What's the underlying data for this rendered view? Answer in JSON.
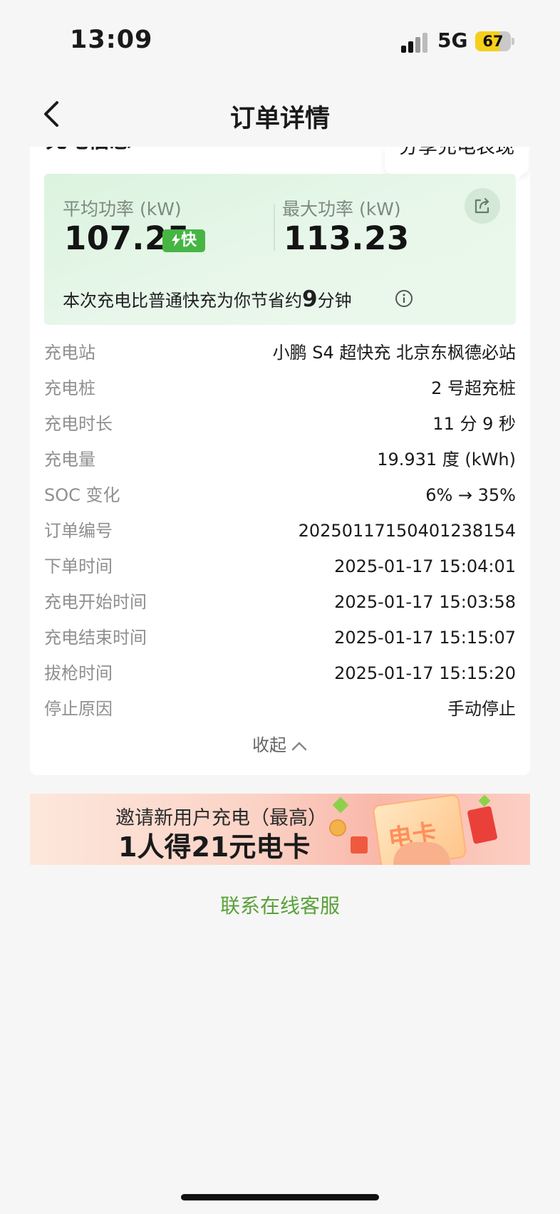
{
  "status_bar": {
    "time": "13:09",
    "network": "5G",
    "battery": "67",
    "battery_level": 0.67
  },
  "nav": {
    "title": "订单详情",
    "back_icon": "chevron-left-icon"
  },
  "section": {
    "title": "充电信息",
    "share_tooltip": "分享充电表现"
  },
  "power": {
    "avg_label": "平均功率 (kW)",
    "avg_value": "107.25",
    "fast_badge": "快",
    "max_label": "最大功率 (kW)",
    "max_value": "113.23",
    "share_icon": "share-icon",
    "saving_prefix": "本次充电比普通快充为你节省约",
    "saving_minutes": "9",
    "saving_suffix": "分钟",
    "info_icon": "info-icon"
  },
  "details": [
    {
      "label": "充电站",
      "value": "小鹏 S4 超快充 北京东枫德必站"
    },
    {
      "label": "充电桩",
      "value": "2 号超充桩"
    },
    {
      "label": "充电时长",
      "value": "11 分 9 秒"
    },
    {
      "label": "充电量",
      "value": "19.931 度 (kWh)"
    },
    {
      "label": "SOC 变化",
      "value": "6% → 35%"
    },
    {
      "label": "订单编号",
      "value": "2025011715040123​8154"
    },
    {
      "label": "下单时间",
      "value": "2025-01-17 15:04:01"
    },
    {
      "label": "充电开始时间",
      "value": "2025-01-17 15:03:58"
    },
    {
      "label": "充电结束时间",
      "value": "2025-01-17 15:15:07"
    },
    {
      "label": "拔枪时间",
      "value": "2025-01-17 15:15:20"
    },
    {
      "label": "停止原因",
      "value": "手动停止"
    }
  ],
  "collapse_label": "收起",
  "banner": {
    "line1": "邀请新用户充电（最高）",
    "line2": "1人得21元电卡",
    "card_text": "电卡"
  },
  "contact_label": "联系在线客服",
  "colors": {
    "accent_green": "#47b543",
    "link_green": "#5aa13a",
    "battery_yellow": "#f5cf1c"
  }
}
